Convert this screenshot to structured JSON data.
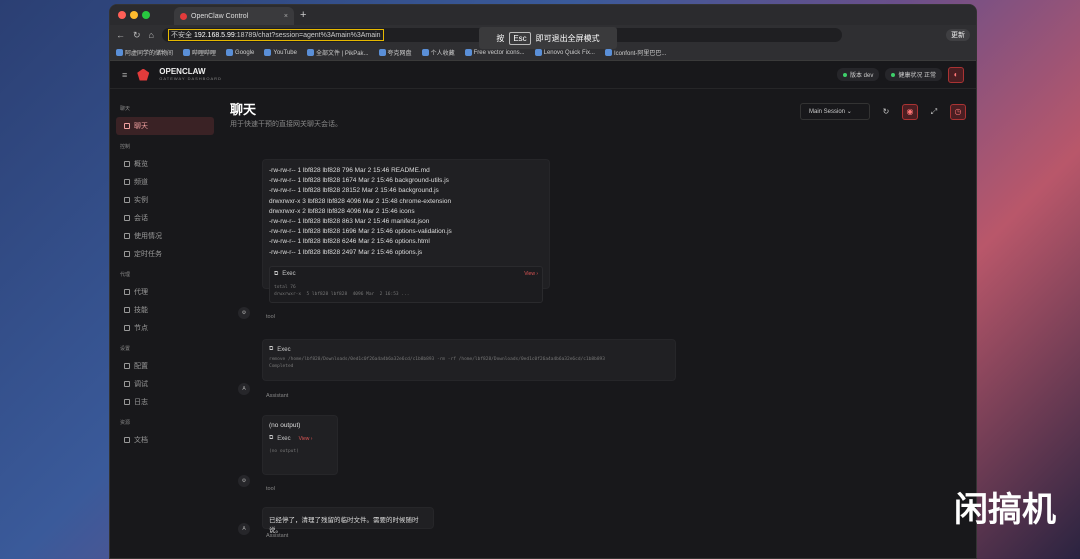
{
  "browser": {
    "tab_title": "OpenClaw Control",
    "insecure": "不安全",
    "host": "192.168.5.99",
    "path": ":18789/chat?session=agent%3Amain%3Amain",
    "update": "更新"
  },
  "bookmarks": [
    "阿虚同学的储物间",
    "哔哩哔哩",
    "Google",
    "YouTube",
    "全部文件 | PikPak...",
    "夸克网盘",
    "个人收藏",
    "Free vector icons...",
    "Lenovo Quick Fix...",
    "Iconfont-阿里巴巴..."
  ],
  "esc_hint": {
    "pre": "按",
    "key": "Esc",
    "post": "即可退出全屏模式"
  },
  "app": {
    "brand": "OPENCLAW",
    "tagline": "GATEWAY DASHBOARD",
    "version": "版本 dev",
    "health": "健康状况 正常"
  },
  "sidebar": [
    {
      "section": "聊天",
      "items": [
        "聊天"
      ]
    },
    {
      "section": "控制",
      "items": [
        "概览",
        "频道",
        "实例",
        "会话",
        "使用情况",
        "定时任务"
      ]
    },
    {
      "section": "代理",
      "items": [
        "代理",
        "技能",
        "节点"
      ]
    },
    {
      "section": "设置",
      "items": [
        "配置",
        "调试",
        "日志"
      ]
    },
    {
      "section": "资源",
      "items": [
        "文档"
      ]
    }
  ],
  "page": {
    "title": "聊天",
    "subtitle": "用于快速干预的直接网关聊天会话。",
    "session": "Main Session"
  },
  "listing": [
    "-rw-rw-r-- 1 lbf828 lbf828 796 Mar 2 15:46 README.md",
    "-rw-rw-r-- 1 lbf828 lbf828 1674 Mar 2 15:46 background-utils.js",
    "-rw-rw-r-- 1 lbf828 lbf828 28152 Mar 2 15:46 background.js",
    "drwxrwxr-x 3 lbf828 lbf828 4096 Mar 2 15:48 chrome-extension",
    "drwxrwxr-x 2 lbf828 lbf828 4096 Mar 2 15:46 icons",
    "-rw-rw-r-- 1 lbf828 lbf828 863 Mar 2 15:46 manifest.json",
    "-rw-rw-r-- 1 lbf828 lbf828 1696 Mar 2 15:46 options-validation.js",
    "-rw-rw-r-- 1 lbf828 lbf828 6246 Mar 2 15:46 options.html",
    "-rw-rw-r-- 1 lbf828 lbf828 2497 Mar 2 15:46 options.js"
  ],
  "exec1": {
    "label": "Exec",
    "view": "View ›",
    "out": "total 76\ndrwxrwxr-x  5 lbf828 lbf828  4096 Mar  2 16:53 ..."
  },
  "tool1": "tool",
  "exec2": {
    "label": "Exec",
    "cmd": "remove /home/lbf828/Downloads/0ed1c0f26a4a4b6a32e6cd/c1b8b893 -rm -rf /home/lbf828/Downloads/0ed1c0f26a4a4b6a32e6cd/c1b8b893",
    "status": "Completed"
  },
  "assistant1": "Assistant",
  "no_output": "(no output)",
  "exec3": {
    "label": "Exec",
    "view": "View ›",
    "out": "(no output)"
  },
  "tool2": "tool",
  "final_msg": "已经停了，清理了残留的临时文件。需要的时候随时说。",
  "assistant2": "Assistant",
  "watermark": "闲搞机"
}
